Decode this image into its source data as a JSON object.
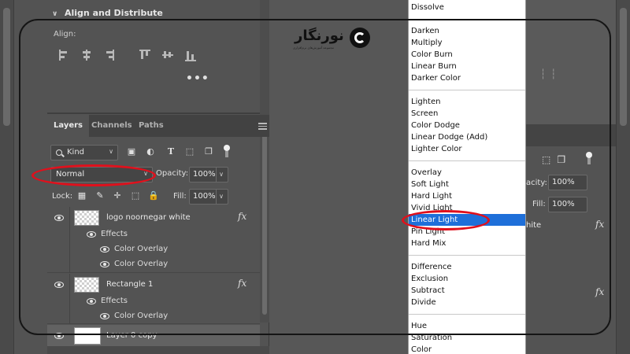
{
  "align_panel": {
    "title": "Align and Distribute",
    "align_label": "Align:",
    "more_label": "•••"
  },
  "layers_panel": {
    "tabs": [
      {
        "label": "Layers",
        "active": true
      },
      {
        "label": "Channels",
        "active": false
      },
      {
        "label": "Paths",
        "active": false
      }
    ],
    "filter": {
      "kind_label": "Kind"
    },
    "blend_mode": "Normal",
    "opacity_label": "Opacity:",
    "opacity_value": "100%",
    "lock_label": "Lock:",
    "fill_label": "Fill:",
    "fill_value": "100%",
    "layers": [
      {
        "name": "logo noornegar white",
        "fx": "fx",
        "effects_label": "Effects",
        "effects": [
          "Color Overlay",
          "Color Overlay"
        ]
      },
      {
        "name": "Rectangle 1",
        "fx": "fx",
        "effects_label": "Effects",
        "effects": [
          "Color Overlay"
        ]
      },
      {
        "name": "Layer 0 copy"
      }
    ]
  },
  "logo": {
    "name": "نورنگار",
    "tagline": "مجموعه آموزش‌های نرم‌افزاری"
  },
  "blend_menu": {
    "selected": "Linear Light",
    "groups": [
      [
        "Dissolve"
      ],
      [
        "Darken",
        "Multiply",
        "Color Burn",
        "Linear Burn",
        "Darker Color"
      ],
      [
        "Lighten",
        "Screen",
        "Color Dodge",
        "Linear Dodge (Add)",
        "Lighter Color"
      ],
      [
        "Overlay",
        "Soft Light",
        "Hard Light",
        "Vivid Light",
        "Linear Light",
        "Pin Light",
        "Hard Mix"
      ],
      [
        "Difference",
        "Exclusion",
        "Subtract",
        "Divide"
      ],
      [
        "Hue",
        "Saturation",
        "Color"
      ]
    ]
  },
  "right_panel": {
    "opacity_partial": "acity:",
    "opacity_value": "100%",
    "fill_label": "Fill:",
    "fill_value": "100%",
    "layer_partial": "hite",
    "fx": "fx"
  },
  "colors": {
    "panel_bg": "#535353",
    "selection": "#1e6fd9",
    "annotation_red": "#e0101c"
  }
}
